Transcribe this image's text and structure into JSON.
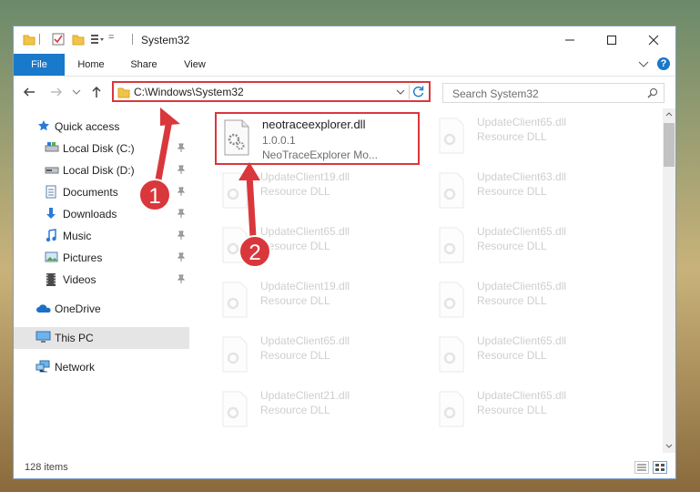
{
  "window": {
    "title": "System32",
    "quick_access_dropdown": "="
  },
  "ribbon": {
    "tabs": [
      "File",
      "Home",
      "Share",
      "View"
    ],
    "help": "?"
  },
  "address": {
    "path": "C:\\Windows\\System32",
    "search_placeholder": "Search System32"
  },
  "sidebar": {
    "items": [
      {
        "label": "Quick access",
        "icon": "star-icon"
      },
      {
        "label": "Local Disk (C:)",
        "icon": "drive-icon",
        "pinned": true
      },
      {
        "label": "Local Disk (D:)",
        "icon": "drive-icon",
        "pinned": true
      },
      {
        "label": "Documents",
        "icon": "documents-icon",
        "pinned": true
      },
      {
        "label": "Downloads",
        "icon": "download-icon",
        "pinned": true
      },
      {
        "label": "Music",
        "icon": "music-icon",
        "pinned": true
      },
      {
        "label": "Pictures",
        "icon": "pictures-icon",
        "pinned": true
      },
      {
        "label": "Videos",
        "icon": "videos-icon",
        "pinned": true
      },
      {
        "label": "OneDrive",
        "icon": "cloud-icon"
      },
      {
        "label": "This PC",
        "icon": "computer-icon",
        "selected": true
      },
      {
        "label": "Network",
        "icon": "network-icon"
      }
    ]
  },
  "files": {
    "highlighted": {
      "name": "neotraceexplorer.dll",
      "version": "1.0.0.1",
      "description": "NeoTraceExplorer Mo..."
    },
    "left_column": [
      {
        "name": "UpdateClient19.dll",
        "type": "Resource DLL"
      },
      {
        "name": "UpdateClient65.dll",
        "type": "Resource DLL"
      },
      {
        "name": "UpdateClient19.dll",
        "type": "Resource DLL"
      },
      {
        "name": "UpdateClient65.dll",
        "type": "Resource DLL"
      },
      {
        "name": "UpdateClient21.dll",
        "type": "Resource DLL"
      }
    ],
    "right_column": [
      {
        "name": "UpdateClient65.dll",
        "type": "Resource DLL"
      },
      {
        "name": "UpdateClient63.dll",
        "type": "Resource DLL"
      },
      {
        "name": "UpdateClient65.dll",
        "type": "Resource DLL"
      },
      {
        "name": "UpdateClient65.dll",
        "type": "Resource DLL"
      },
      {
        "name": "UpdateClient65.dll",
        "type": "Resource DLL"
      },
      {
        "name": "UpdateClient65.dll",
        "type": "Resource DLL"
      }
    ]
  },
  "status": {
    "item_count": "128 items"
  },
  "annotations": {
    "step1": "1",
    "step2": "2",
    "color": "#d9373c"
  },
  "colors": {
    "accent": "#1979ca",
    "highlight": "#d9373c",
    "selected_bg": "#e5e5e5"
  }
}
